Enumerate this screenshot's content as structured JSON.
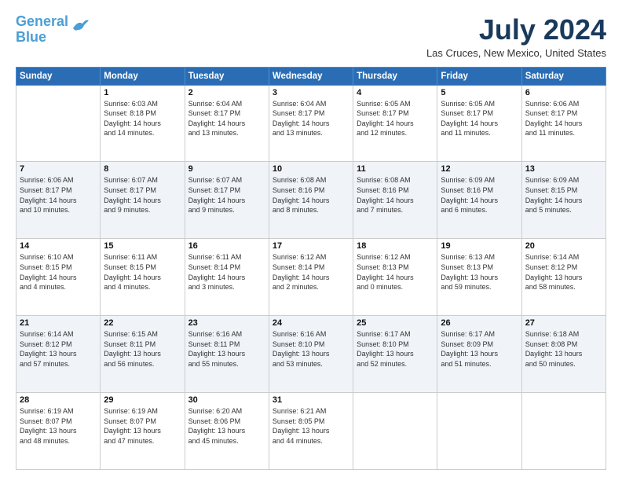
{
  "header": {
    "logo_line1": "General",
    "logo_line2": "Blue",
    "month": "July 2024",
    "location": "Las Cruces, New Mexico, United States"
  },
  "weekdays": [
    "Sunday",
    "Monday",
    "Tuesday",
    "Wednesday",
    "Thursday",
    "Friday",
    "Saturday"
  ],
  "weeks": [
    [
      {
        "day": "",
        "text": ""
      },
      {
        "day": "1",
        "text": "Sunrise: 6:03 AM\nSunset: 8:18 PM\nDaylight: 14 hours\nand 14 minutes."
      },
      {
        "day": "2",
        "text": "Sunrise: 6:04 AM\nSunset: 8:17 PM\nDaylight: 14 hours\nand 13 minutes."
      },
      {
        "day": "3",
        "text": "Sunrise: 6:04 AM\nSunset: 8:17 PM\nDaylight: 14 hours\nand 13 minutes."
      },
      {
        "day": "4",
        "text": "Sunrise: 6:05 AM\nSunset: 8:17 PM\nDaylight: 14 hours\nand 12 minutes."
      },
      {
        "day": "5",
        "text": "Sunrise: 6:05 AM\nSunset: 8:17 PM\nDaylight: 14 hours\nand 11 minutes."
      },
      {
        "day": "6",
        "text": "Sunrise: 6:06 AM\nSunset: 8:17 PM\nDaylight: 14 hours\nand 11 minutes."
      }
    ],
    [
      {
        "day": "7",
        "text": "Sunrise: 6:06 AM\nSunset: 8:17 PM\nDaylight: 14 hours\nand 10 minutes."
      },
      {
        "day": "8",
        "text": "Sunrise: 6:07 AM\nSunset: 8:17 PM\nDaylight: 14 hours\nand 9 minutes."
      },
      {
        "day": "9",
        "text": "Sunrise: 6:07 AM\nSunset: 8:17 PM\nDaylight: 14 hours\nand 9 minutes."
      },
      {
        "day": "10",
        "text": "Sunrise: 6:08 AM\nSunset: 8:16 PM\nDaylight: 14 hours\nand 8 minutes."
      },
      {
        "day": "11",
        "text": "Sunrise: 6:08 AM\nSunset: 8:16 PM\nDaylight: 14 hours\nand 7 minutes."
      },
      {
        "day": "12",
        "text": "Sunrise: 6:09 AM\nSunset: 8:16 PM\nDaylight: 14 hours\nand 6 minutes."
      },
      {
        "day": "13",
        "text": "Sunrise: 6:09 AM\nSunset: 8:15 PM\nDaylight: 14 hours\nand 5 minutes."
      }
    ],
    [
      {
        "day": "14",
        "text": "Sunrise: 6:10 AM\nSunset: 8:15 PM\nDaylight: 14 hours\nand 4 minutes."
      },
      {
        "day": "15",
        "text": "Sunrise: 6:11 AM\nSunset: 8:15 PM\nDaylight: 14 hours\nand 4 minutes."
      },
      {
        "day": "16",
        "text": "Sunrise: 6:11 AM\nSunset: 8:14 PM\nDaylight: 14 hours\nand 3 minutes."
      },
      {
        "day": "17",
        "text": "Sunrise: 6:12 AM\nSunset: 8:14 PM\nDaylight: 14 hours\nand 2 minutes."
      },
      {
        "day": "18",
        "text": "Sunrise: 6:12 AM\nSunset: 8:13 PM\nDaylight: 14 hours\nand 0 minutes."
      },
      {
        "day": "19",
        "text": "Sunrise: 6:13 AM\nSunset: 8:13 PM\nDaylight: 13 hours\nand 59 minutes."
      },
      {
        "day": "20",
        "text": "Sunrise: 6:14 AM\nSunset: 8:12 PM\nDaylight: 13 hours\nand 58 minutes."
      }
    ],
    [
      {
        "day": "21",
        "text": "Sunrise: 6:14 AM\nSunset: 8:12 PM\nDaylight: 13 hours\nand 57 minutes."
      },
      {
        "day": "22",
        "text": "Sunrise: 6:15 AM\nSunset: 8:11 PM\nDaylight: 13 hours\nand 56 minutes."
      },
      {
        "day": "23",
        "text": "Sunrise: 6:16 AM\nSunset: 8:11 PM\nDaylight: 13 hours\nand 55 minutes."
      },
      {
        "day": "24",
        "text": "Sunrise: 6:16 AM\nSunset: 8:10 PM\nDaylight: 13 hours\nand 53 minutes."
      },
      {
        "day": "25",
        "text": "Sunrise: 6:17 AM\nSunset: 8:10 PM\nDaylight: 13 hours\nand 52 minutes."
      },
      {
        "day": "26",
        "text": "Sunrise: 6:17 AM\nSunset: 8:09 PM\nDaylight: 13 hours\nand 51 minutes."
      },
      {
        "day": "27",
        "text": "Sunrise: 6:18 AM\nSunset: 8:08 PM\nDaylight: 13 hours\nand 50 minutes."
      }
    ],
    [
      {
        "day": "28",
        "text": "Sunrise: 6:19 AM\nSunset: 8:07 PM\nDaylight: 13 hours\nand 48 minutes."
      },
      {
        "day": "29",
        "text": "Sunrise: 6:19 AM\nSunset: 8:07 PM\nDaylight: 13 hours\nand 47 minutes."
      },
      {
        "day": "30",
        "text": "Sunrise: 6:20 AM\nSunset: 8:06 PM\nDaylight: 13 hours\nand 45 minutes."
      },
      {
        "day": "31",
        "text": "Sunrise: 6:21 AM\nSunset: 8:05 PM\nDaylight: 13 hours\nand 44 minutes."
      },
      {
        "day": "",
        "text": ""
      },
      {
        "day": "",
        "text": ""
      },
      {
        "day": "",
        "text": ""
      }
    ]
  ]
}
